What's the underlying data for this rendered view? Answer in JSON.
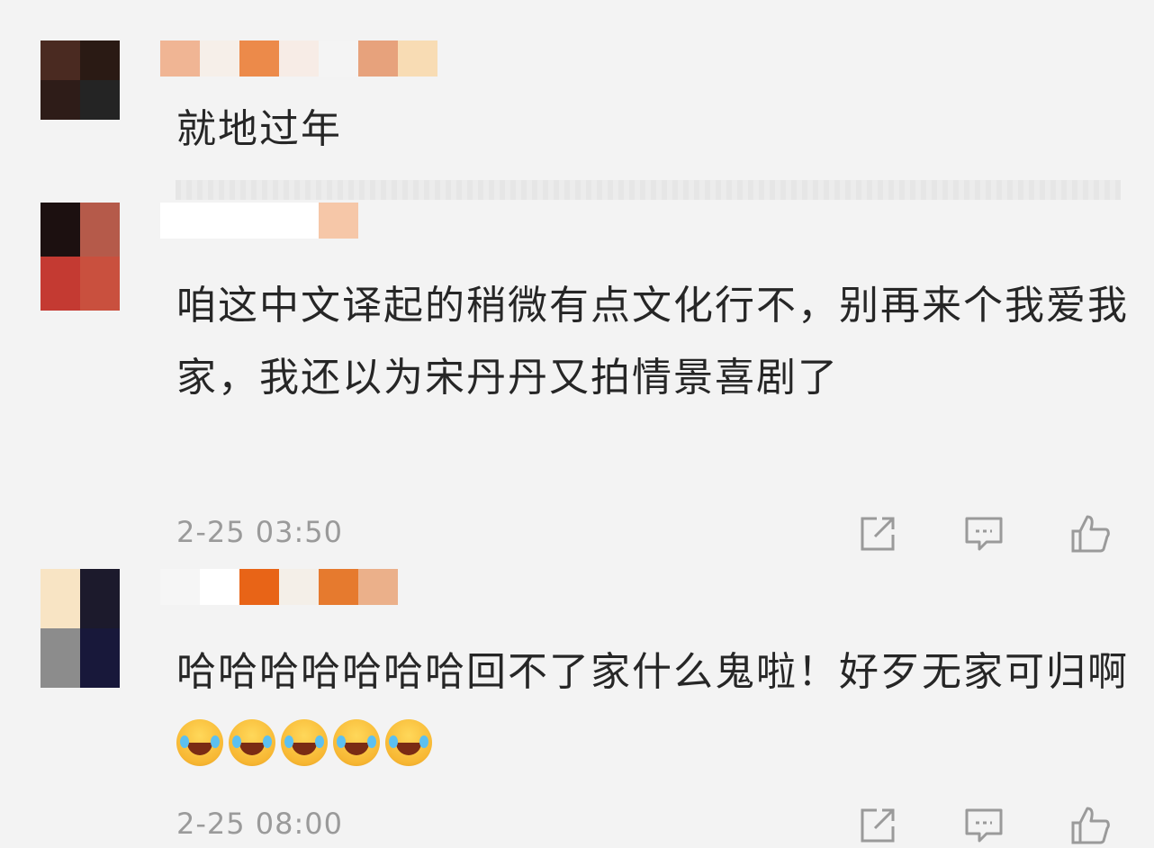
{
  "comments": [
    {
      "text": "就地过年",
      "time": "",
      "avatar_colors": [
        "#4a2a21",
        "#2a1a14",
        "#2e1c18",
        "#242424"
      ],
      "name_colors": [
        "#f0b594",
        "#f6efe9",
        "#ec8a4a",
        "#f7ece6",
        "#f4f4f4",
        "#e7a27c",
        "#f8dcb4"
      ]
    },
    {
      "text": "咱这中文译起的稍微有点文化行不，别再来个我爱我家，我还以为宋丹丹又拍情景喜剧了",
      "time": "2-25 03:50",
      "avatar_colors": [
        "#1c1010",
        "#b55a4a",
        "#c43a32",
        "#c9503e"
      ],
      "name_colors": [
        "#ffffff",
        "#ffffff",
        "#ffffff",
        "#ffffff",
        "#f6c7a8"
      ]
    },
    {
      "text": "哈哈哈哈哈哈哈回不了家什么鬼啦！好歹无家可归啊",
      "emoji_count": 5,
      "emoji_name": "laughing-tears-emoji",
      "time": "2-25 08:00",
      "avatar_colors": [
        "#f8e4c4",
        "#1c1a2c",
        "#8c8c8c",
        "#18183a"
      ],
      "name_colors": [
        "#f6f6f6",
        "#ffffff",
        "#e86417",
        "#f4efe8",
        "#e67a2e",
        "#ebb08a"
      ]
    }
  ],
  "icons": {
    "share": "share-icon",
    "reply": "reply-icon",
    "like": "thumbs-up-icon"
  }
}
